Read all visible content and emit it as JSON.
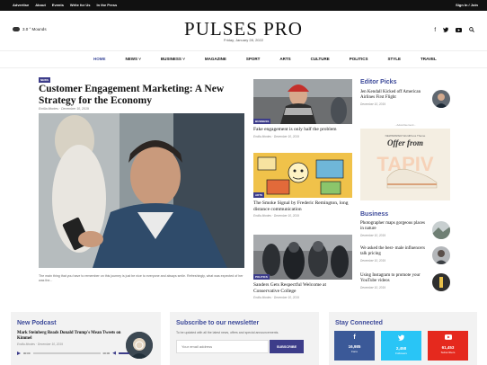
{
  "topbar": {
    "links": [
      "Advertise",
      "About",
      "Events",
      "Write for Us",
      "In the Press"
    ],
    "auth": "Sign In / Join"
  },
  "header": {
    "weather": "3.0 °  Mounds",
    "logo": "PULSES PRO",
    "date": "Friday, January 28, 2022",
    "social_icons": [
      "facebook-icon",
      "twitter-icon",
      "youtube-icon",
      "search-icon"
    ]
  },
  "nav": {
    "items": [
      "HOME",
      "NEWS",
      "BUSINESS",
      "MAGAZINE",
      "SPORT",
      "ARTS",
      "CULTURE",
      "POLITICS",
      "STYLE",
      "TRAVEL"
    ]
  },
  "featured": {
    "badge": "NEWS",
    "title": "Customer Engagement Marketing: A New Strategy for the Economy",
    "meta": "Emilia Montes  ·  December 10, 2019",
    "excerpt": "The main thing that you have to remember on this journey is just be nice to everyone and always smile. Refreshingly, what was expected of her was the..."
  },
  "middle": [
    {
      "badge": "BUSINESS",
      "title": "Fake engagement is only half the problem",
      "meta": "Emilia Montes  ·  December 10, 2019"
    },
    {
      "badge": "ARTS",
      "title": "The Smoke Signal by Frederic Remington, long distance communication",
      "meta": "Emilia Montes  ·  December 10, 2019"
    },
    {
      "badge": "POLITICS",
      "title": "Sanders Gets Respectful Welcome at Conservative College",
      "meta": "Emilia Montes  ·  December 10, 2019"
    }
  ],
  "editor_picks": {
    "title": "Editor Picks",
    "items": [
      {
        "title": "Jen Kendall Kicked off American Airlines First Flight",
        "meta": "December 10, 2019"
      }
    ]
  },
  "ad": {
    "label": "- Advertisement -",
    "brand": "NEWSPAPER WordPress Theme",
    "headline": "Offer from",
    "big": "TAPIV"
  },
  "business": {
    "title": "Business",
    "items": [
      {
        "title": "Photographer maps gorgeous places in nature",
        "meta": "December 10, 2019"
      },
      {
        "title": "We asked the best- male influencers talk pricing",
        "meta": "December 10, 2019"
      },
      {
        "title": "Using Instagram to promote your YouTube videos",
        "meta": "December 10, 2019"
      }
    ]
  },
  "podcast": {
    "title": "New Podcast",
    "episode": "Mark Steinberg Reads Donald Trump's Mean Tweets on Kimmel",
    "meta": "Emilia Montes  ·  December 10, 2019",
    "time_start": "00:00",
    "time_end": "00:00"
  },
  "newsletter": {
    "title": "Subscribe to our newsletter",
    "text": "To be updated with all the latest news, offers and special announcements.",
    "placeholder": "Your email address",
    "button": "SUBSCRIBE"
  },
  "stay": {
    "title": "Stay Connected",
    "buttons": [
      {
        "icon": "facebook-icon",
        "count": "16,985",
        "label": "Fans",
        "color": "#3b5998"
      },
      {
        "icon": "twitter-icon",
        "count": "2,458",
        "label": "Followers",
        "color": "#29c5f6"
      },
      {
        "icon": "youtube-icon",
        "count": "61,453",
        "label": "Subscribers",
        "color": "#e5291e"
      }
    ]
  }
}
